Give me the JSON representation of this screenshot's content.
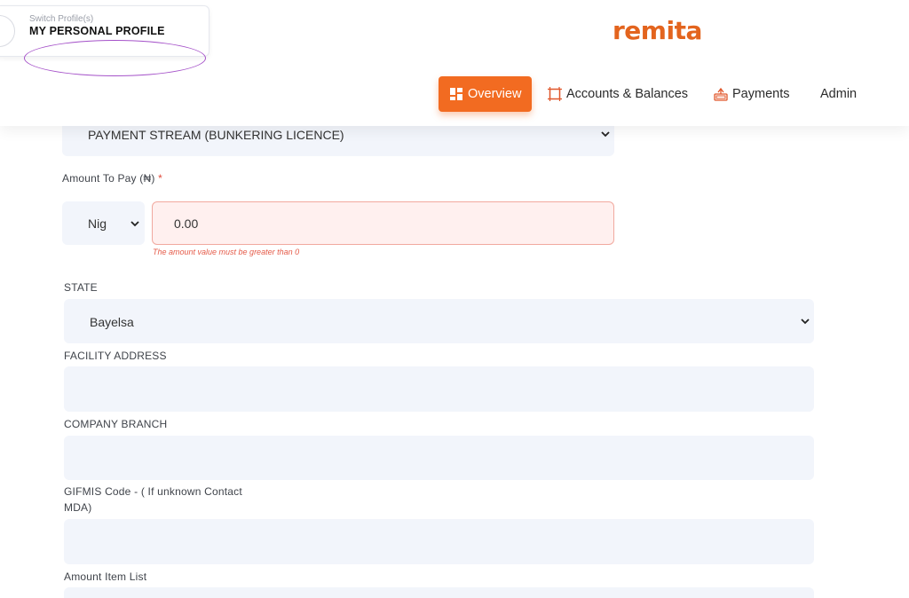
{
  "profile": {
    "switch_label": "Switch Profile(s)",
    "name": "MY PERSONAL PROFILE"
  },
  "logo": {
    "text": "remita",
    "brand_color": "#f26b21",
    "accent_color": "#2fa6a8"
  },
  "nav": {
    "items": [
      {
        "label": "Overview",
        "icon": "overview-grid-icon",
        "active": true
      },
      {
        "label": "Accounts & Balances",
        "icon": "square-frame-icon"
      },
      {
        "label": "Payments",
        "icon": "payments-icon"
      },
      {
        "label": "Admin"
      }
    ]
  },
  "form": {
    "payment_stream": {
      "value": "PAYMENT STREAM (BUNKERING LICENCE)"
    },
    "amount": {
      "label": "Amount To Pay (₦)",
      "required_mark": "*",
      "currency": "Nig",
      "value": "0.00",
      "error": "The amount value must be greater than 0"
    },
    "state": {
      "label": "STATE",
      "value": "Bayelsa"
    },
    "facility_address": {
      "label": "FACILITY ADDRESS",
      "value": ""
    },
    "company_branch": {
      "label": "COMPANY BRANCH",
      "value": ""
    },
    "gifmis": {
      "label_line1": "GIFMIS Code - ( If unknown Contact",
      "label_line2": "MDA)",
      "value": ""
    },
    "amount_item_list": {
      "label": "Amount Item List"
    }
  }
}
